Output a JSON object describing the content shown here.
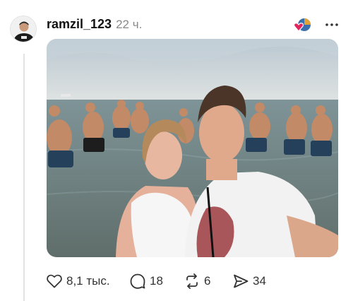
{
  "post": {
    "username": "ramzil_123",
    "time": "22 ч.",
    "actions": {
      "likes": "8,1 тыс.",
      "replies": "18",
      "reposts": "6",
      "shares": "34"
    }
  },
  "icons": {
    "more": "more-dots-icon",
    "like": "heart-icon",
    "reply": "comment-bubble-icon",
    "repost": "repost-arrows-icon",
    "share": "send-arrow-icon",
    "badge": "heart-emoji-badge-icon"
  },
  "colors": {
    "heart_badge": "#e0245e",
    "secondary_text": "#8a8a8a"
  }
}
